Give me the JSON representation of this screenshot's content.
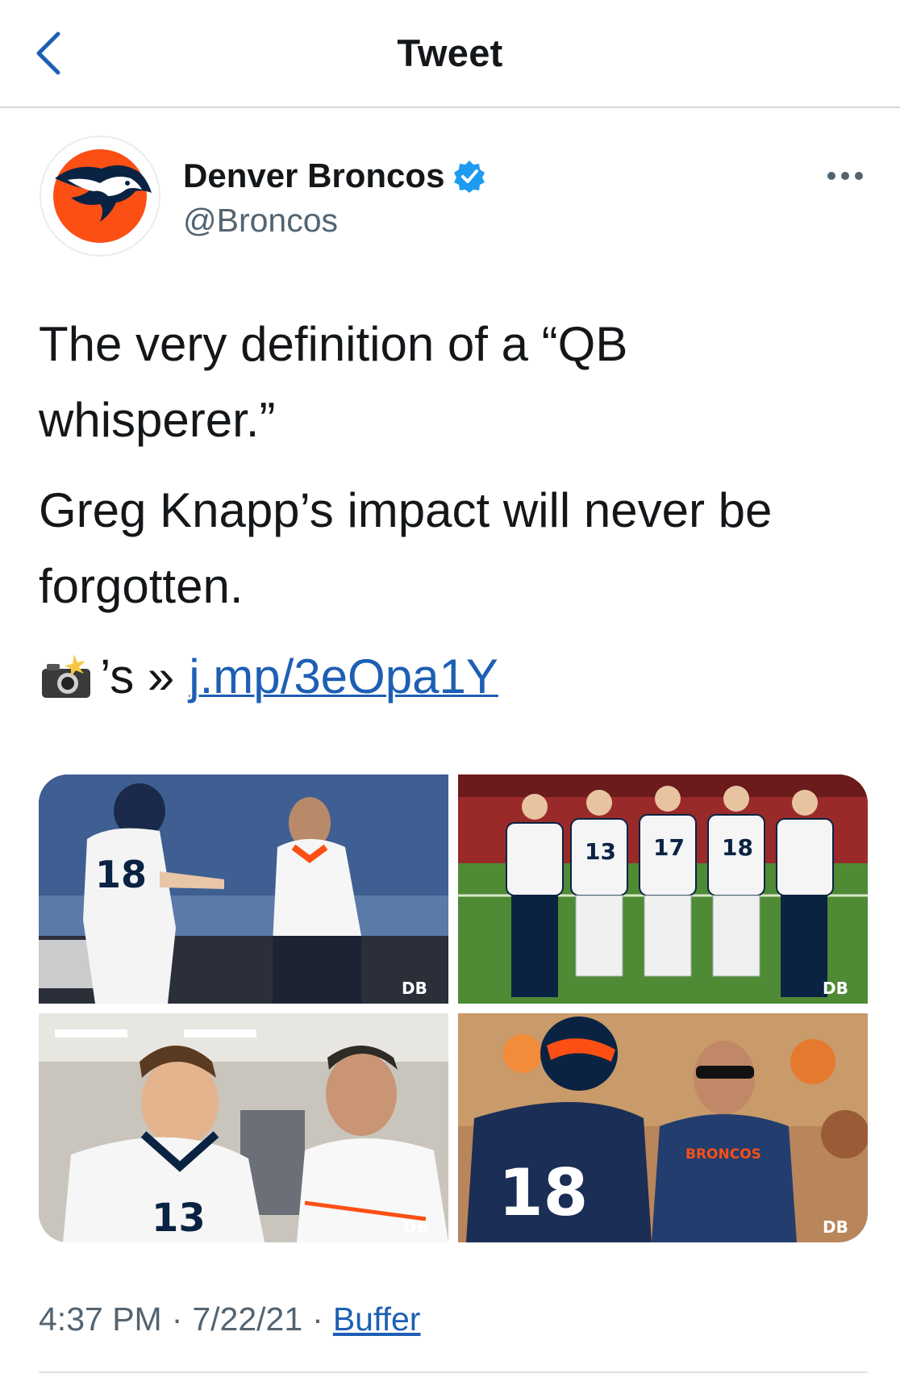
{
  "nav": {
    "title": "Tweet",
    "back_icon": "chevron-left-icon"
  },
  "account": {
    "display_name": "Denver Broncos",
    "handle": "@Broncos",
    "verified_icon": "verified-badge-icon",
    "avatar_icon": "broncos-logo-icon",
    "more_icon": "more-dots-icon"
  },
  "tweet": {
    "paragraph1_line1": "The very definition of a “QB",
    "paragraph1_line2": "whisperer.”",
    "paragraph2_line1": "Greg Knapp’s impact will never be",
    "paragraph2_line2": "forgotten.",
    "emoji_icon": "camera-flash-icon",
    "link_prefix": "’s »",
    "link_text": "j.mp/3eOpa1Y"
  },
  "media": {
    "photos": [
      {
        "overlay_number": "18",
        "watermark": "DB"
      },
      {
        "jersey_numbers": [
          "13",
          "17",
          "18"
        ],
        "watermark": "DB"
      },
      {
        "overlay_number": "13",
        "watermark": "DB"
      },
      {
        "overlay_number": "18",
        "shirt_text": "BRONCOS",
        "watermark": "DB"
      }
    ]
  },
  "meta": {
    "time": "4:37 PM",
    "separator": "·",
    "date": "7/22/21",
    "source": "Buffer"
  },
  "colors": {
    "link": "#1d5fb4",
    "verified": "#1d9bf0",
    "broncos_orange": "#fb4f14",
    "broncos_navy": "#0a2343"
  }
}
